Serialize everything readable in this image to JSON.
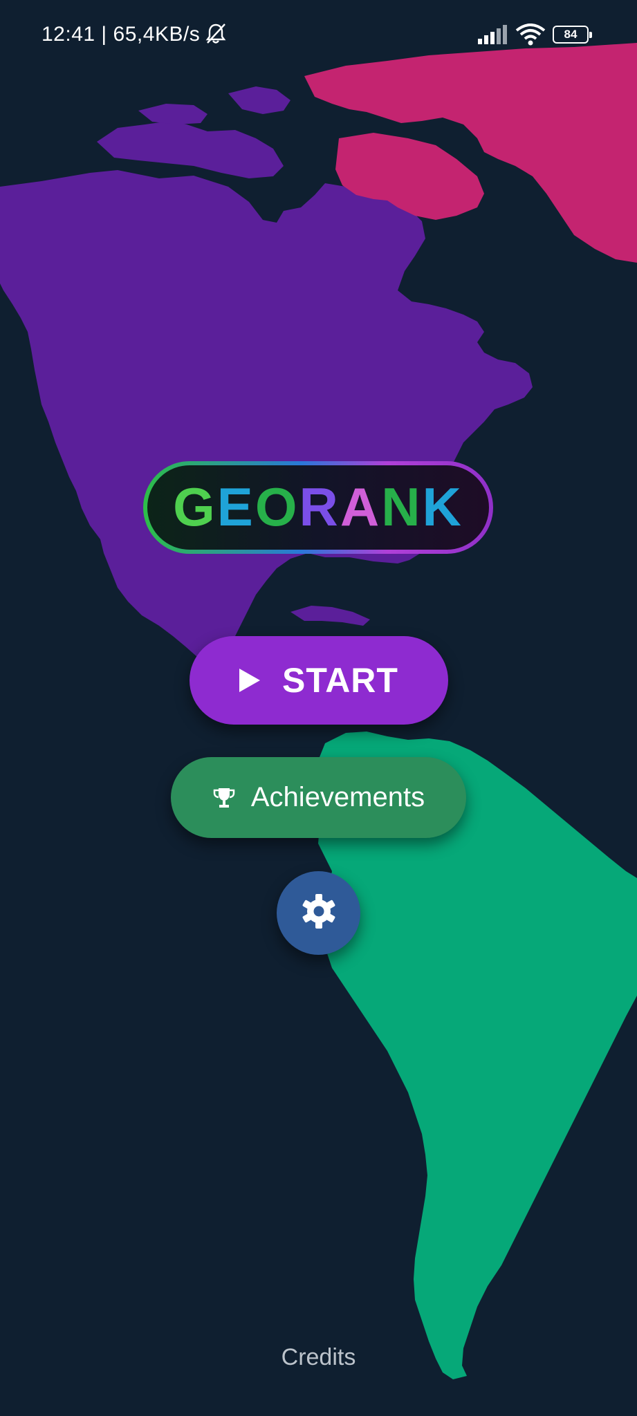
{
  "status_bar": {
    "time": "12:41",
    "network_speed": "| 65,4KB/s",
    "battery_level": "84",
    "icons": [
      "bell-off-icon",
      "signal-icon",
      "wifi-icon",
      "battery-icon"
    ]
  },
  "logo": {
    "text": "GEORANK",
    "colors": [
      "#4fd04f",
      "#1fa3d8",
      "#27b04a",
      "#7b4fe8",
      "#d05fd8",
      "#27b04a",
      "#1fa3d8"
    ]
  },
  "buttons": {
    "start_label": "START",
    "achievements_label": "Achievements",
    "settings_icon": "gear-icon"
  },
  "credits_label": "Credits",
  "colors": {
    "background": "#0f1f30",
    "north_america": "#5b1f9a",
    "greenland": "#c42470",
    "south_america": "#06a878",
    "start_button": "#8e2bd0",
    "achievements_button": "#2c8e5b",
    "settings_button": "#2f5a98"
  }
}
